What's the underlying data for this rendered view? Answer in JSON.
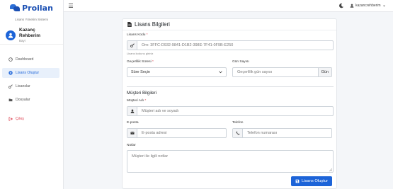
{
  "sidebar": {
    "brand_name": "Proilan",
    "brand_subtitle": "Lisans Yönetim Sistemi",
    "user": {
      "name": "Kazanç Rehberim",
      "role": "Bayi"
    },
    "items": [
      {
        "label": "Dashboard",
        "icon": "dashboard-icon"
      },
      {
        "label": "Lisans Oluştur",
        "icon": "plus-circle-icon",
        "active": true
      },
      {
        "label": "Lisanslar",
        "icon": "key-icon"
      },
      {
        "label": "Dosyalar",
        "icon": "folder-icon"
      },
      {
        "label": "Çıkış",
        "icon": "logout-icon"
      }
    ]
  },
  "topbar": {
    "username": "kazancrehberim",
    "icons": [
      "hamburger-icon",
      "moon-icon",
      "user-icon",
      "caret-down-icon"
    ]
  },
  "card": {
    "title": "Lisans Bilgileri",
    "license_code": {
      "label": "Lisans Kodu",
      "placeholder": "Örn: 3FFC-D932-9841-D1B2-398E-7F41-0F9B-E250",
      "help": "Lisans kodunu giriniz"
    },
    "validity": {
      "label": "Geçerlilik Süresi",
      "value": "Süre Seçin"
    },
    "days": {
      "label": "Gün Sayısı",
      "placeholder": "Geçerlilik gün sayısı",
      "suffix": "Gün"
    },
    "customer_section": "Müşteri Bilgileri",
    "customer_name": {
      "label": "Müşteri Adı",
      "placeholder": "Müşteri adı ve soyadı"
    },
    "email": {
      "label": "E-posta",
      "placeholder": "E-posta adresi"
    },
    "phone": {
      "label": "Telefon",
      "placeholder": "Telefon numarası"
    },
    "notes": {
      "label": "Notlar",
      "placeholder": "Müşteri ile ilgili notlar"
    },
    "submit_label": "Lisans Oluştur"
  },
  "colors": {
    "primary": "#1d64d8",
    "danger": "#dc3545",
    "active_bg": "#e8f0fb"
  }
}
